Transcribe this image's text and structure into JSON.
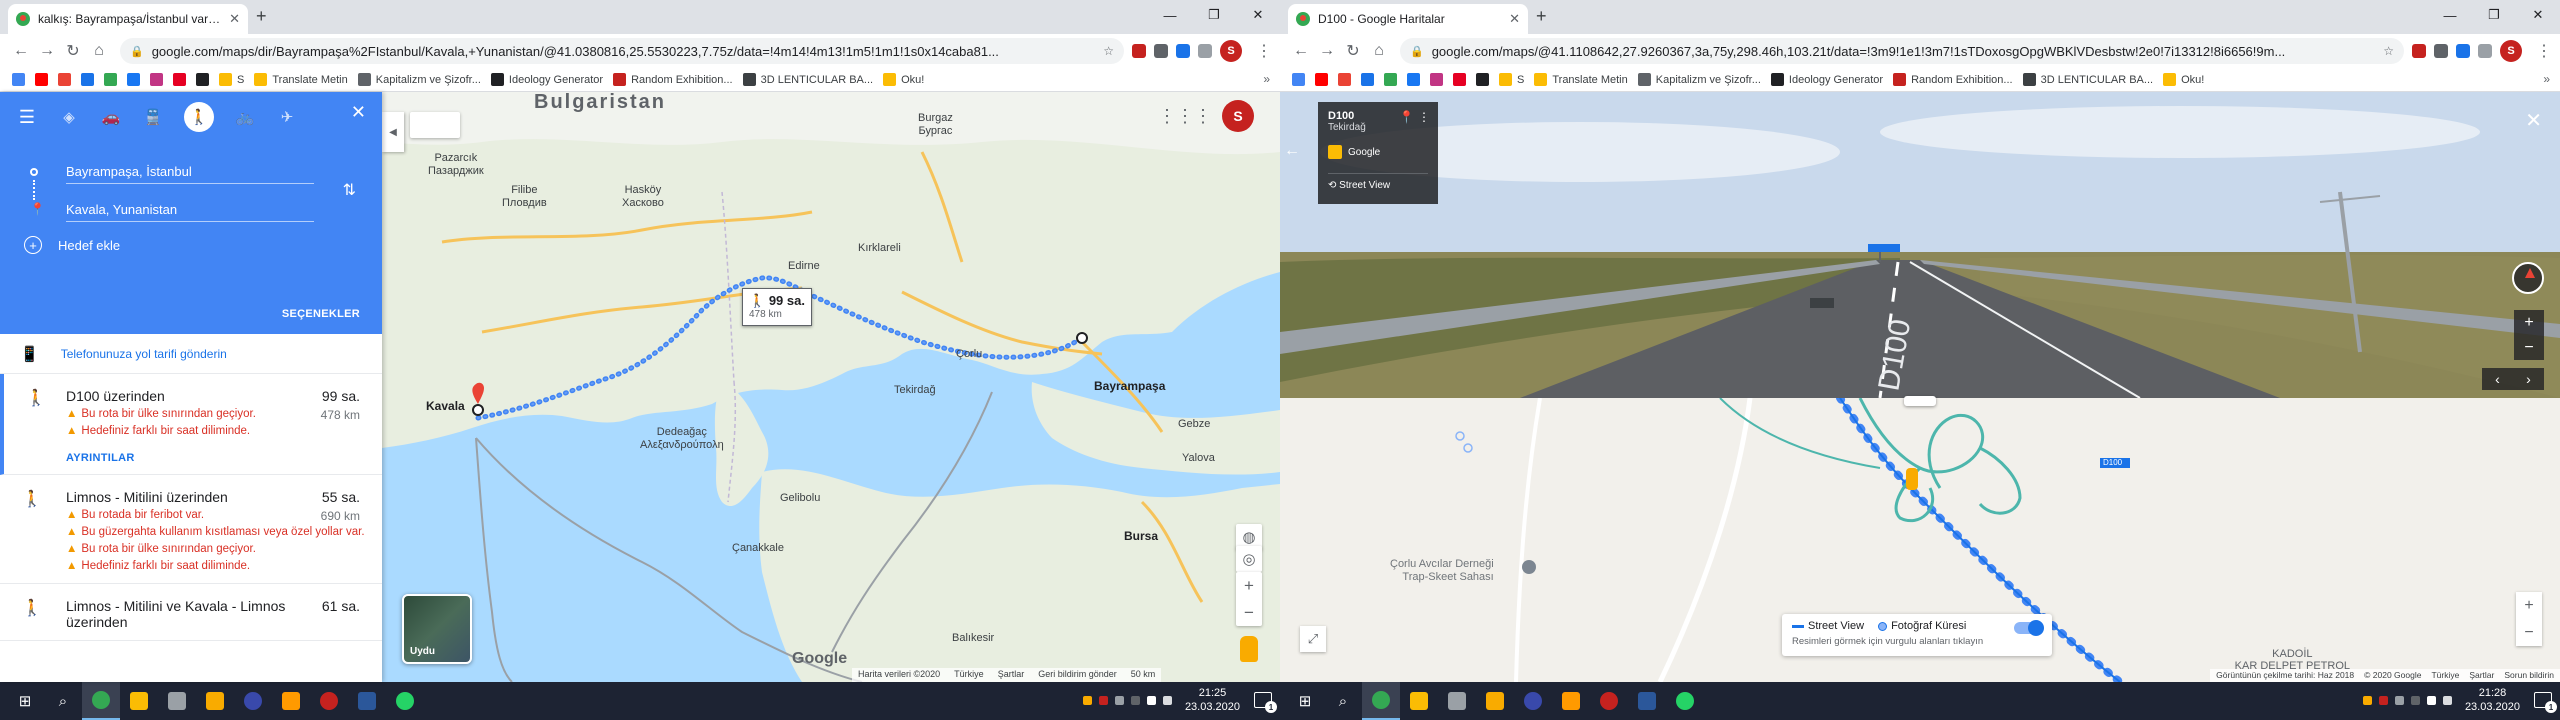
{
  "left": {
    "tab": {
      "title": "kalkış: Bayrampaşa/İstanbul varış:..."
    },
    "url": "google.com/maps/dir/Bayrampaşa%2FIstanbul/Kavala,+Yunanistan/@41.0380816,25.5530223,7.75z/data=!4m14!4m13!1m5!1m1!1s0x14caba81...",
    "bookmarks": [
      "S",
      "Translate Metin",
      "Kapitalizm ve Şizofr...",
      "Ideology Generator",
      "Random Exhibition...",
      "3D LENTICULAR BA...",
      "Oku!"
    ],
    "directions": {
      "origin": "Bayrampaşa, İstanbul",
      "destination": "Kavala, Yunanistan",
      "add_destination": "Hedef ekle",
      "options": "SEÇENEKLER",
      "send_to_phone": "Telefonunuza yol tarifi gönderin",
      "routes": [
        {
          "name": "D100 üzerinden",
          "time": "99 sa.",
          "distance": "478 km",
          "warnings": [
            "Bu rota bir ülke sınırından geçiyor.",
            "Hedefiniz farklı bir saat diliminde."
          ],
          "details": "AYRINTILAR"
        },
        {
          "name": "Limnos - Mitilini üzerinden",
          "time": "55 sa.",
          "distance": "690 km",
          "warnings": [
            "Bu rotada bir feribot var.",
            "Bu güzergahta kullanım kısıtlaması veya özel yollar var.",
            "Bu rota bir ülke sınırından geçiyor.",
            "Hedefiniz farklı bir saat diliminde."
          ]
        },
        {
          "name": "Limnos - Mitilini ve Kavala - Limnos üzerinden",
          "time": "61 sa."
        }
      ]
    },
    "map": {
      "labels": {
        "bulgaristan": "Bulgaristan",
        "pazarcik": "Pazarcık\nПазарджик",
        "filibe": "Filibe\nПловдив",
        "haskoy": "Hasköy\nХасково",
        "burgaz": "Burgaz\nБургас",
        "edirne": "Edirne",
        "kirklareli": "Kırklareli",
        "corlu": "Çorlu",
        "tekirdag": "Tekirdağ",
        "kavala": "Kavala",
        "bayrampasa": "Bayrampaşa",
        "dedeagac": "Dedeağaç\nΑλεξανδρούπολη",
        "gebze": "Gebze",
        "yalova": "Yalova",
        "gelibolu": "Gelibolu",
        "canakkale": "Çanakkale",
        "balikesir": "Balıkesir",
        "bursa": "Bursa"
      },
      "route_box": {
        "time": "99 sa.",
        "dist": "478 km"
      },
      "satellite": "Uydu",
      "footer": [
        "Harita verileri ©2020",
        "Türkiye",
        "Şartlar",
        "Geri bildirim gönder",
        "50 km"
      ],
      "avatar": "S"
    },
    "taskbar": {
      "time": "21:25",
      "date": "23.03.2020",
      "notif": "1"
    }
  },
  "right": {
    "tab": {
      "title": "D100 - Google Haritalar"
    },
    "url": "google.com/maps/@41.1108642,27.9260367,3a,75y,298.46h,103.21t/data=!3m9!1e1!3m7!1sTDoxosgOpgWBKlVDesbstw!2e0!7i13312!8i6656!9m...",
    "bookmarks": [
      "S",
      "Translate Metin",
      "Kapitalizm ve Şizofr...",
      "Ideology Generator",
      "Random Exhibition...",
      "3D LENTICULAR BA...",
      "Oku!"
    ],
    "streetview": {
      "location": "D100",
      "sub": "Tekirdağ",
      "owner": "Google",
      "mode": "Street View"
    },
    "minimap": {
      "poi": "Çorlu Avcılar Derneği\nTrap-Skeet Sahası",
      "biz": "KADOİL\nKAR DELPET PETROL",
      "legend": {
        "sv": "Street View",
        "photo": "Fotoğraf Küresi",
        "hint": "Resimleri görmek için vurgulu alanları tıklayın"
      },
      "footer": [
        "Görüntünün çekilme tarihi: Haz 2018",
        "© 2020 Google",
        "Türkiye",
        "Şartlar",
        "Sorun bildirin"
      ],
      "road": "D100"
    },
    "taskbar": {
      "time": "21:28",
      "date": "23.03.2020",
      "notif": "1"
    }
  }
}
